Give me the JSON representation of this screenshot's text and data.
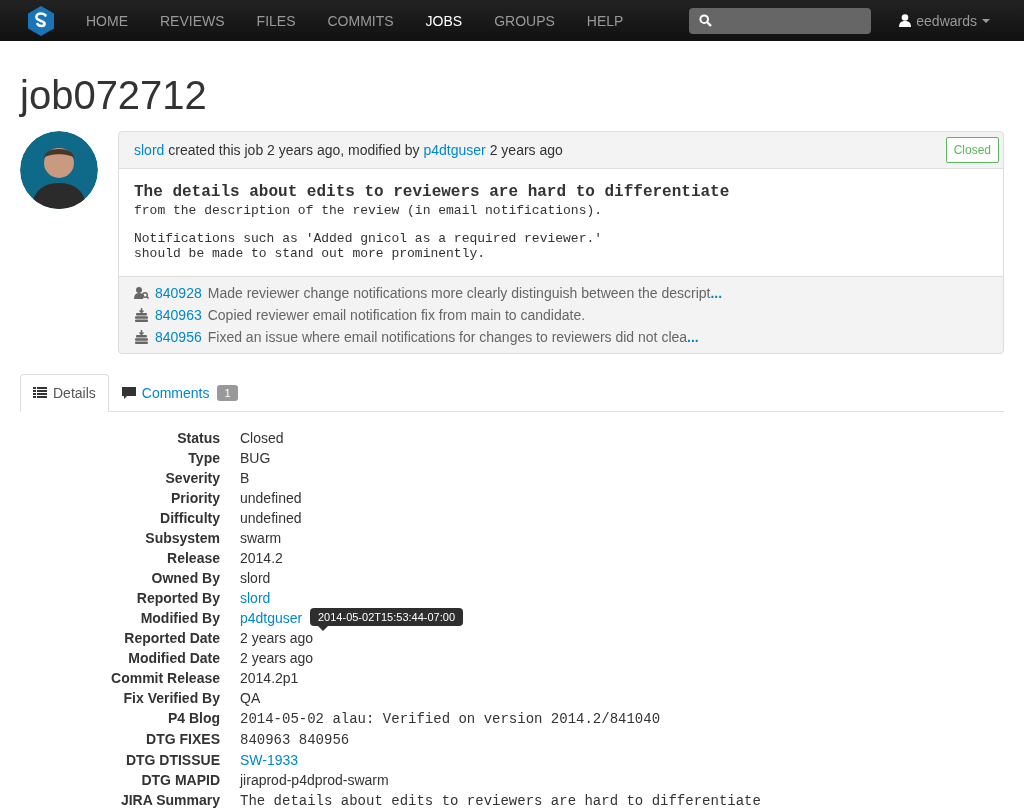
{
  "nav": {
    "items": [
      {
        "label": "HOME",
        "selected": false
      },
      {
        "label": "REVIEWS",
        "selected": false
      },
      {
        "label": "FILES",
        "selected": false
      },
      {
        "label": "COMMITS",
        "selected": false
      },
      {
        "label": "JOBS",
        "selected": true
      },
      {
        "label": "GROUPS",
        "selected": false
      },
      {
        "label": "HELP",
        "selected": false
      }
    ],
    "user": "eedwards"
  },
  "job": {
    "id": "job072712",
    "header": {
      "author": "slord",
      "middle": " created this job 2 years ago, modified by ",
      "modifier": "p4dtguser",
      "end": " 2 years ago"
    },
    "status": "Closed",
    "description": {
      "title": "The details about edits to reviewers are hard to differentiate",
      "paragraphs": [
        "from the description of the review (in email notifications).",
        "Notifications such as 'Added gnicol as a required reviewer.'\nshould be made to stand out more prominently."
      ]
    },
    "changes": [
      {
        "kind": "review",
        "id": "840928",
        "text": "Made reviewer change notifications more clearly distinguish between the descript",
        "more": "..."
      },
      {
        "kind": "commit",
        "id": "840963",
        "text": "Copied reviewer email notification fix from main to candidate."
      },
      {
        "kind": "commit",
        "id": "840956",
        "text": "Fixed an issue where email notifications for changes to reviewers did not clea",
        "more": "..."
      }
    ]
  },
  "tabs": [
    {
      "kind": "details",
      "label": "Details",
      "selected": true
    },
    {
      "kind": "comments",
      "label": "Comments",
      "count": "1",
      "selected": false
    }
  ],
  "fields": [
    {
      "label": "Status",
      "value": "Closed",
      "kind": "text"
    },
    {
      "label": "Type",
      "value": "BUG",
      "kind": "text"
    },
    {
      "label": "Severity",
      "value": "B",
      "kind": "text"
    },
    {
      "label": "Priority",
      "value": "undefined",
      "kind": "text"
    },
    {
      "label": "Difficulty",
      "value": "undefined",
      "kind": "text"
    },
    {
      "label": "Subsystem",
      "value": "swarm",
      "kind": "text"
    },
    {
      "label": "Release",
      "value": "2014.2",
      "kind": "text"
    },
    {
      "label": "Owned By",
      "value": "slord",
      "kind": "text"
    },
    {
      "label": "Reported By",
      "value": "slord",
      "kind": "link"
    },
    {
      "label": "Modified By",
      "value": "p4dtguser",
      "kind": "link"
    },
    {
      "label": "Reported Date",
      "value": "2 years ago",
      "kind": "text",
      "tooltip": "2014-05-02T15:53:44-07:00"
    },
    {
      "label": "Modified Date",
      "value": "2 years ago",
      "kind": "text"
    },
    {
      "label": "Commit Release",
      "value": "2014.2p1",
      "kind": "text"
    },
    {
      "label": "Fix Verified By",
      "value": "QA",
      "kind": "text"
    },
    {
      "label": "P4 Blog",
      "value": "2014-05-02 alau: Verified on version 2014.2/841040",
      "kind": "mono"
    },
    {
      "label": "DTG FIXES",
      "value": "840963 840956",
      "kind": "mono"
    },
    {
      "label": "DTG DTISSUE",
      "value": "SW-1933",
      "kind": "link"
    },
    {
      "label": "DTG MAPID",
      "value": "jiraprod-p4dprod-swarm",
      "kind": "text"
    },
    {
      "label": "JIRA Summary",
      "value": "The details about edits to reviewers are hard to differentiate",
      "kind": "mono"
    }
  ]
}
